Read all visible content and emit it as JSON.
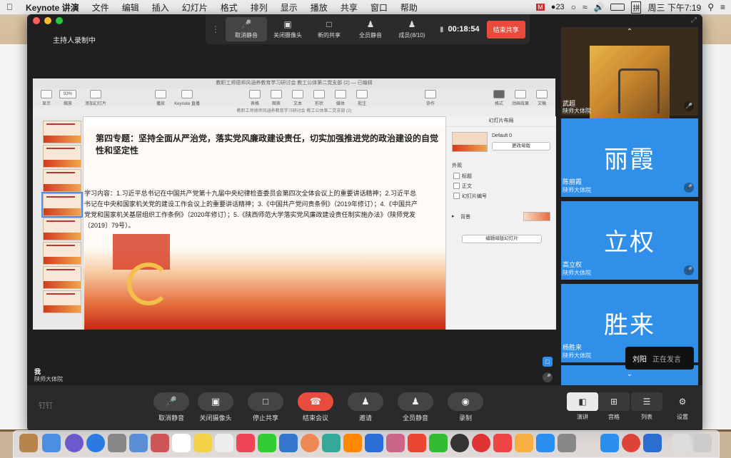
{
  "menubar": {
    "app_name": "Keynote 讲演",
    "items": [
      "文件",
      "编辑",
      "插入",
      "幻灯片",
      "格式",
      "排列",
      "显示",
      "播放",
      "共享",
      "窗口",
      "帮助"
    ],
    "notification_count": "23",
    "clock": "周三 下午7:19"
  },
  "meeting": {
    "host_label": "主持人录制中",
    "top_controls": [
      {
        "label": "取消静音",
        "icon": "mic-icon"
      },
      {
        "label": "关闭摄像头",
        "icon": "camera-icon"
      },
      {
        "label": "新的共享",
        "icon": "share-icon"
      },
      {
        "label": "全员静音",
        "icon": "mute-all-icon"
      },
      {
        "label": "成员(8/10)",
        "icon": "members-icon"
      }
    ],
    "timer": "00:18:54",
    "end_share_label": "结束共享",
    "self": {
      "name": "我",
      "org": "陕师大体院"
    },
    "participants": [
      {
        "name": "武超",
        "org": "陕师大体院",
        "avatar_text": ""
      },
      {
        "name": "陈丽霞",
        "org": "陕师大体院",
        "avatar_text": "丽霞"
      },
      {
        "name": "高立权",
        "org": "陕师大体院",
        "avatar_text": "立权"
      },
      {
        "name": "杨胜来",
        "org": "陕师大体院",
        "avatar_text": "胜来"
      }
    ],
    "speaking": {
      "name": "刘阳",
      "status": "正在发言"
    },
    "bottom_controls": [
      {
        "label": "取消静音",
        "icon": "mic-off-icon"
      },
      {
        "label": "关闭摄像头",
        "icon": "camera-icon"
      },
      {
        "label": "停止共享",
        "icon": "stop-share-icon"
      },
      {
        "label": "结束会议",
        "icon": "hangup-icon"
      },
      {
        "label": "邀请",
        "icon": "invite-icon"
      },
      {
        "label": "全员静音",
        "icon": "mute-all-icon"
      },
      {
        "label": "录制",
        "icon": "record-icon"
      }
    ],
    "view_controls": [
      {
        "label": "演讲",
        "icon": "speaker-view-icon"
      },
      {
        "label": "宫格",
        "icon": "grid-view-icon"
      },
      {
        "label": "列表",
        "icon": "list-view-icon"
      },
      {
        "label": "设置",
        "icon": "gear-icon"
      }
    ],
    "brand": "钉钉"
  },
  "keynote": {
    "window_title": "教职工师德师风涵养教育学习研讨会 教工公体第二党支部 (2) — 已编辑",
    "subtitle": "教职工师德师风涵养教育学习研讨会 教工公体第二党支部 (2)",
    "zoom": "93%",
    "toolbar_left": [
      "显示",
      "缩放",
      "添加幻灯片"
    ],
    "toolbar_mid": [
      "播放",
      "Keynote 直播",
      "表格",
      "图表",
      "文本",
      "形状",
      "媒体",
      "批注"
    ],
    "toolbar_right": [
      "协作",
      "格式",
      "动画效果",
      "文稿"
    ],
    "slide": {
      "title": "第四专题：坚持全面从严治党，落实党风廉政建设责任，切实加强推进党的政治建设的自觉性和坚定性",
      "body": "学习内容：1.习近平总书记在中国共产党第十九届中央纪律检查委员会第四次全体会议上的重要讲话精神；2.习近平总书记在中央和国家机关党的建设工作会议上的重要讲话精神；3.《中国共产党问责条例》（2019年修订）；4.《中国共产党党和国家机关基层组织工作条例》（2020年修订）；5.《陕西师范大学落实党风廉政建设责任制实施办法》（陕师党发〔2019〕79号）。"
    },
    "inspector": {
      "header": "幻灯片布局",
      "master_name": "Default 0",
      "change_master": "更改母版",
      "appearance": "外观",
      "options": [
        "标题",
        "正文",
        "幻灯片编号"
      ],
      "background": "背景",
      "edit_master": "编辑母版幻灯片"
    }
  }
}
